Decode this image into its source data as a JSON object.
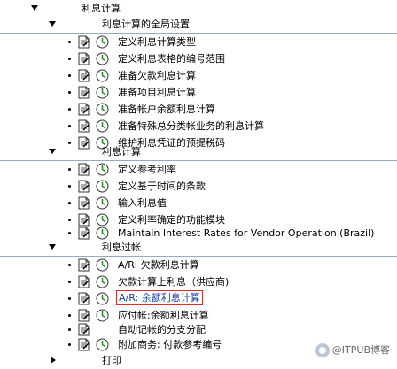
{
  "tree": {
    "root": {
      "label": "利息计算"
    },
    "sections": [
      {
        "label": "利息计算的全局设置",
        "items": [
          {
            "label": "定义利息计算类型"
          },
          {
            "label": "定义利息表格的编号范围"
          },
          {
            "label": "准备欠款利息计算"
          },
          {
            "label": "准备项目利息计算"
          },
          {
            "label": "准备帐户余额利息计算"
          },
          {
            "label": "准备特殊总分类帐业务的利息计算"
          },
          {
            "label": "维护利息凭证的预提税码"
          }
        ]
      },
      {
        "label": "利息计算",
        "items": [
          {
            "label": "定义参考利率"
          },
          {
            "label": "定义基于时间的条款"
          },
          {
            "label": "输入利息值"
          },
          {
            "label": "定义利率确定的功能模块"
          },
          {
            "label": "Maintain Interest Rates for Vendor Operation (Brazil)"
          }
        ]
      },
      {
        "label": "利息过帐",
        "items": [
          {
            "label": "A/R: 欠款利息计算"
          },
          {
            "label": "欠款计算上利息（供应商)"
          },
          {
            "label": "A/R: 余额利息计算"
          },
          {
            "label": "应付帐:余额利息计算"
          },
          {
            "label": "自动记帐的分支分配"
          },
          {
            "label": "附加商务: 付款参考编号"
          }
        ]
      },
      {
        "label": "打印"
      }
    ]
  },
  "watermark": "@ITPUB博客"
}
